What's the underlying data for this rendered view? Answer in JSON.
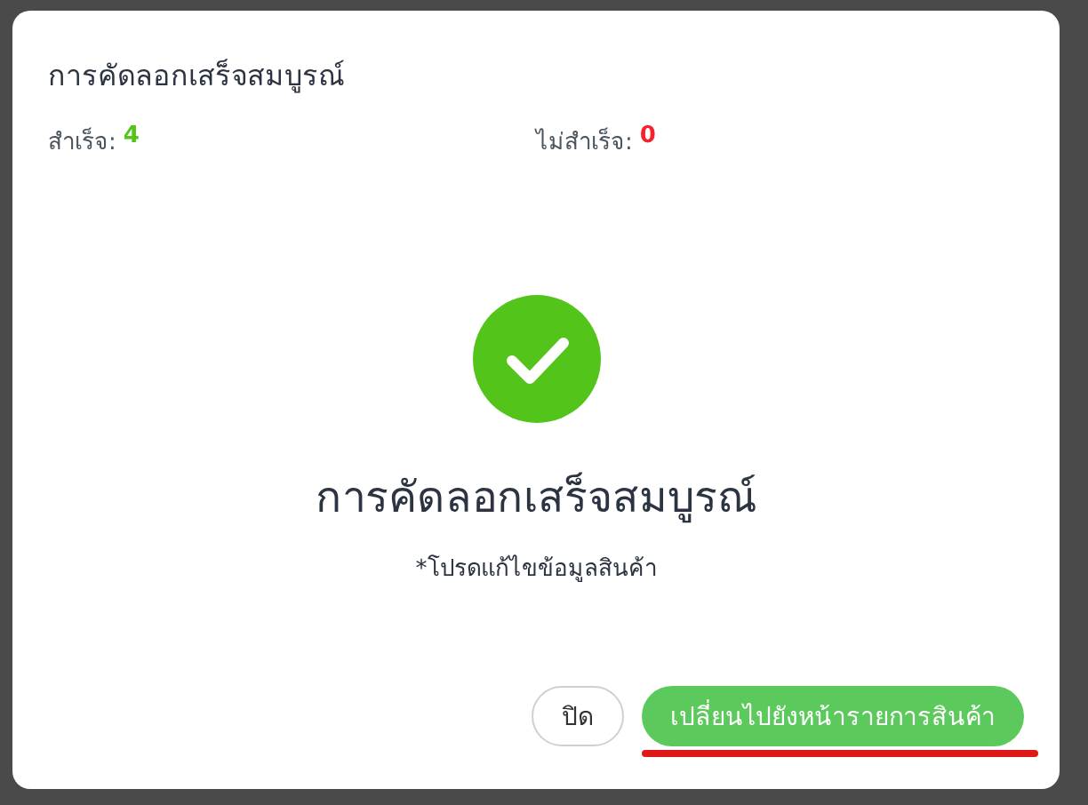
{
  "dialog": {
    "title": "การคัดลอกเสร็จสมบูรณ์",
    "stats": [
      {
        "label": "สำเร็จ:",
        "value": "4",
        "kind": "success"
      },
      {
        "label": "ไม่สำเร็จ:",
        "value": "0",
        "kind": "failure"
      }
    ],
    "heading": "การคัดลอกเสร็จสมบูรณ์",
    "note": "*โปรดแก้ไขข้อมูลสินค้า",
    "buttons": [
      {
        "label": "ปิด",
        "kind": "secondary"
      },
      {
        "label": "เปลี่ยนไปยังหน้ารายการสินค้า",
        "kind": "primary"
      }
    ]
  }
}
